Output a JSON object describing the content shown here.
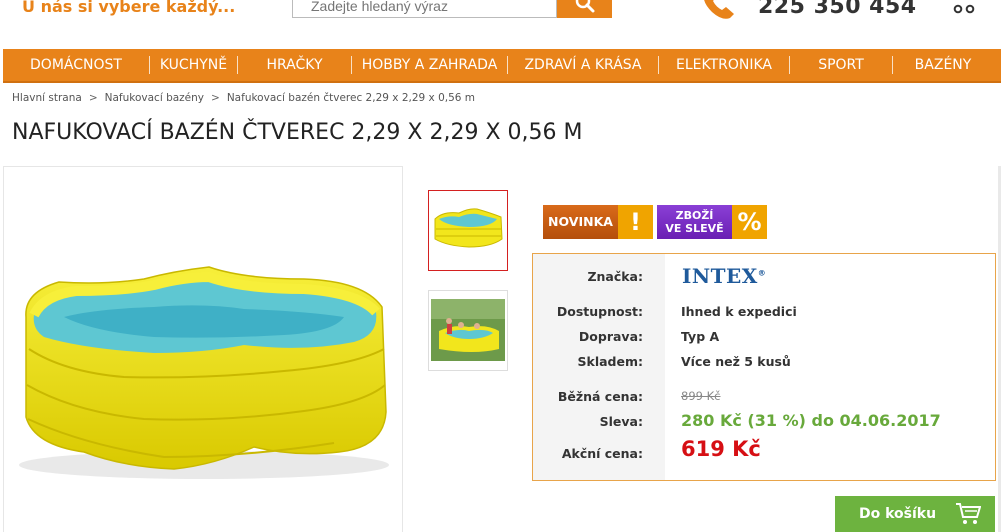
{
  "header": {
    "tagline": "U nás si vybere každý...",
    "search_placeholder": "Zadejte hledaný výraz",
    "phone_number": "225 350 454",
    "icons": {
      "search": "search-icon",
      "phone": "phone-icon",
      "user": "user-icon"
    }
  },
  "nav": {
    "items": [
      {
        "label": "DOMÁCNOST"
      },
      {
        "label": "KUCHYNĚ"
      },
      {
        "label": "HRAČKY"
      },
      {
        "label": "HOBBY A ZAHRADA"
      },
      {
        "label": "ZDRAVÍ A KRÁSA"
      },
      {
        "label": "ELEKTRONIKA"
      },
      {
        "label": "SPORT"
      },
      {
        "label": "BAZÉNY"
      }
    ]
  },
  "breadcrumb": {
    "items": [
      "Hlavní strana",
      "Nafukovací bazény",
      "Nafukovací bazén čtverec 2,29 x 2,29 x 0,56 m"
    ],
    "separator": ">"
  },
  "product": {
    "title": "NAFUKOVACÍ BAZÉN ČTVEREC 2,29 X 2,29 X 0,56 M",
    "badges": {
      "new_label": "NOVINKA",
      "new_mark": "!",
      "sale_label_line1": "ZBOŽÍ",
      "sale_label_line2": "VE SLEVĚ",
      "sale_mark": "%"
    },
    "info": {
      "brand_label": "Značka:",
      "brand_logo": "INTEX",
      "brand_logo_mark": "®",
      "availability_label": "Dostupnost:",
      "availability_value": "Ihned k expedici",
      "shipping_label": "Doprava:",
      "shipping_value": "Typ A",
      "stock_label": "Skladem:",
      "stock_value": "Více než 5 kusů",
      "regular_price_label": "Běžná cena:",
      "regular_price_value": "899 Kč",
      "discount_label": "Sleva:",
      "discount_value": "280 Kč (31 %) do 04.06.2017",
      "sale_price_label": "Akční cena:",
      "sale_price_value": "619 Kč"
    },
    "cart_button_label": "Do košíku"
  },
  "colors": {
    "accent_orange": "#e8831a",
    "price_red": "#d60f14",
    "discount_green": "#68a93b",
    "cart_green": "#6db33f",
    "sale_purple": "#7a2fc6",
    "brand_blue": "#1f5a9b"
  }
}
